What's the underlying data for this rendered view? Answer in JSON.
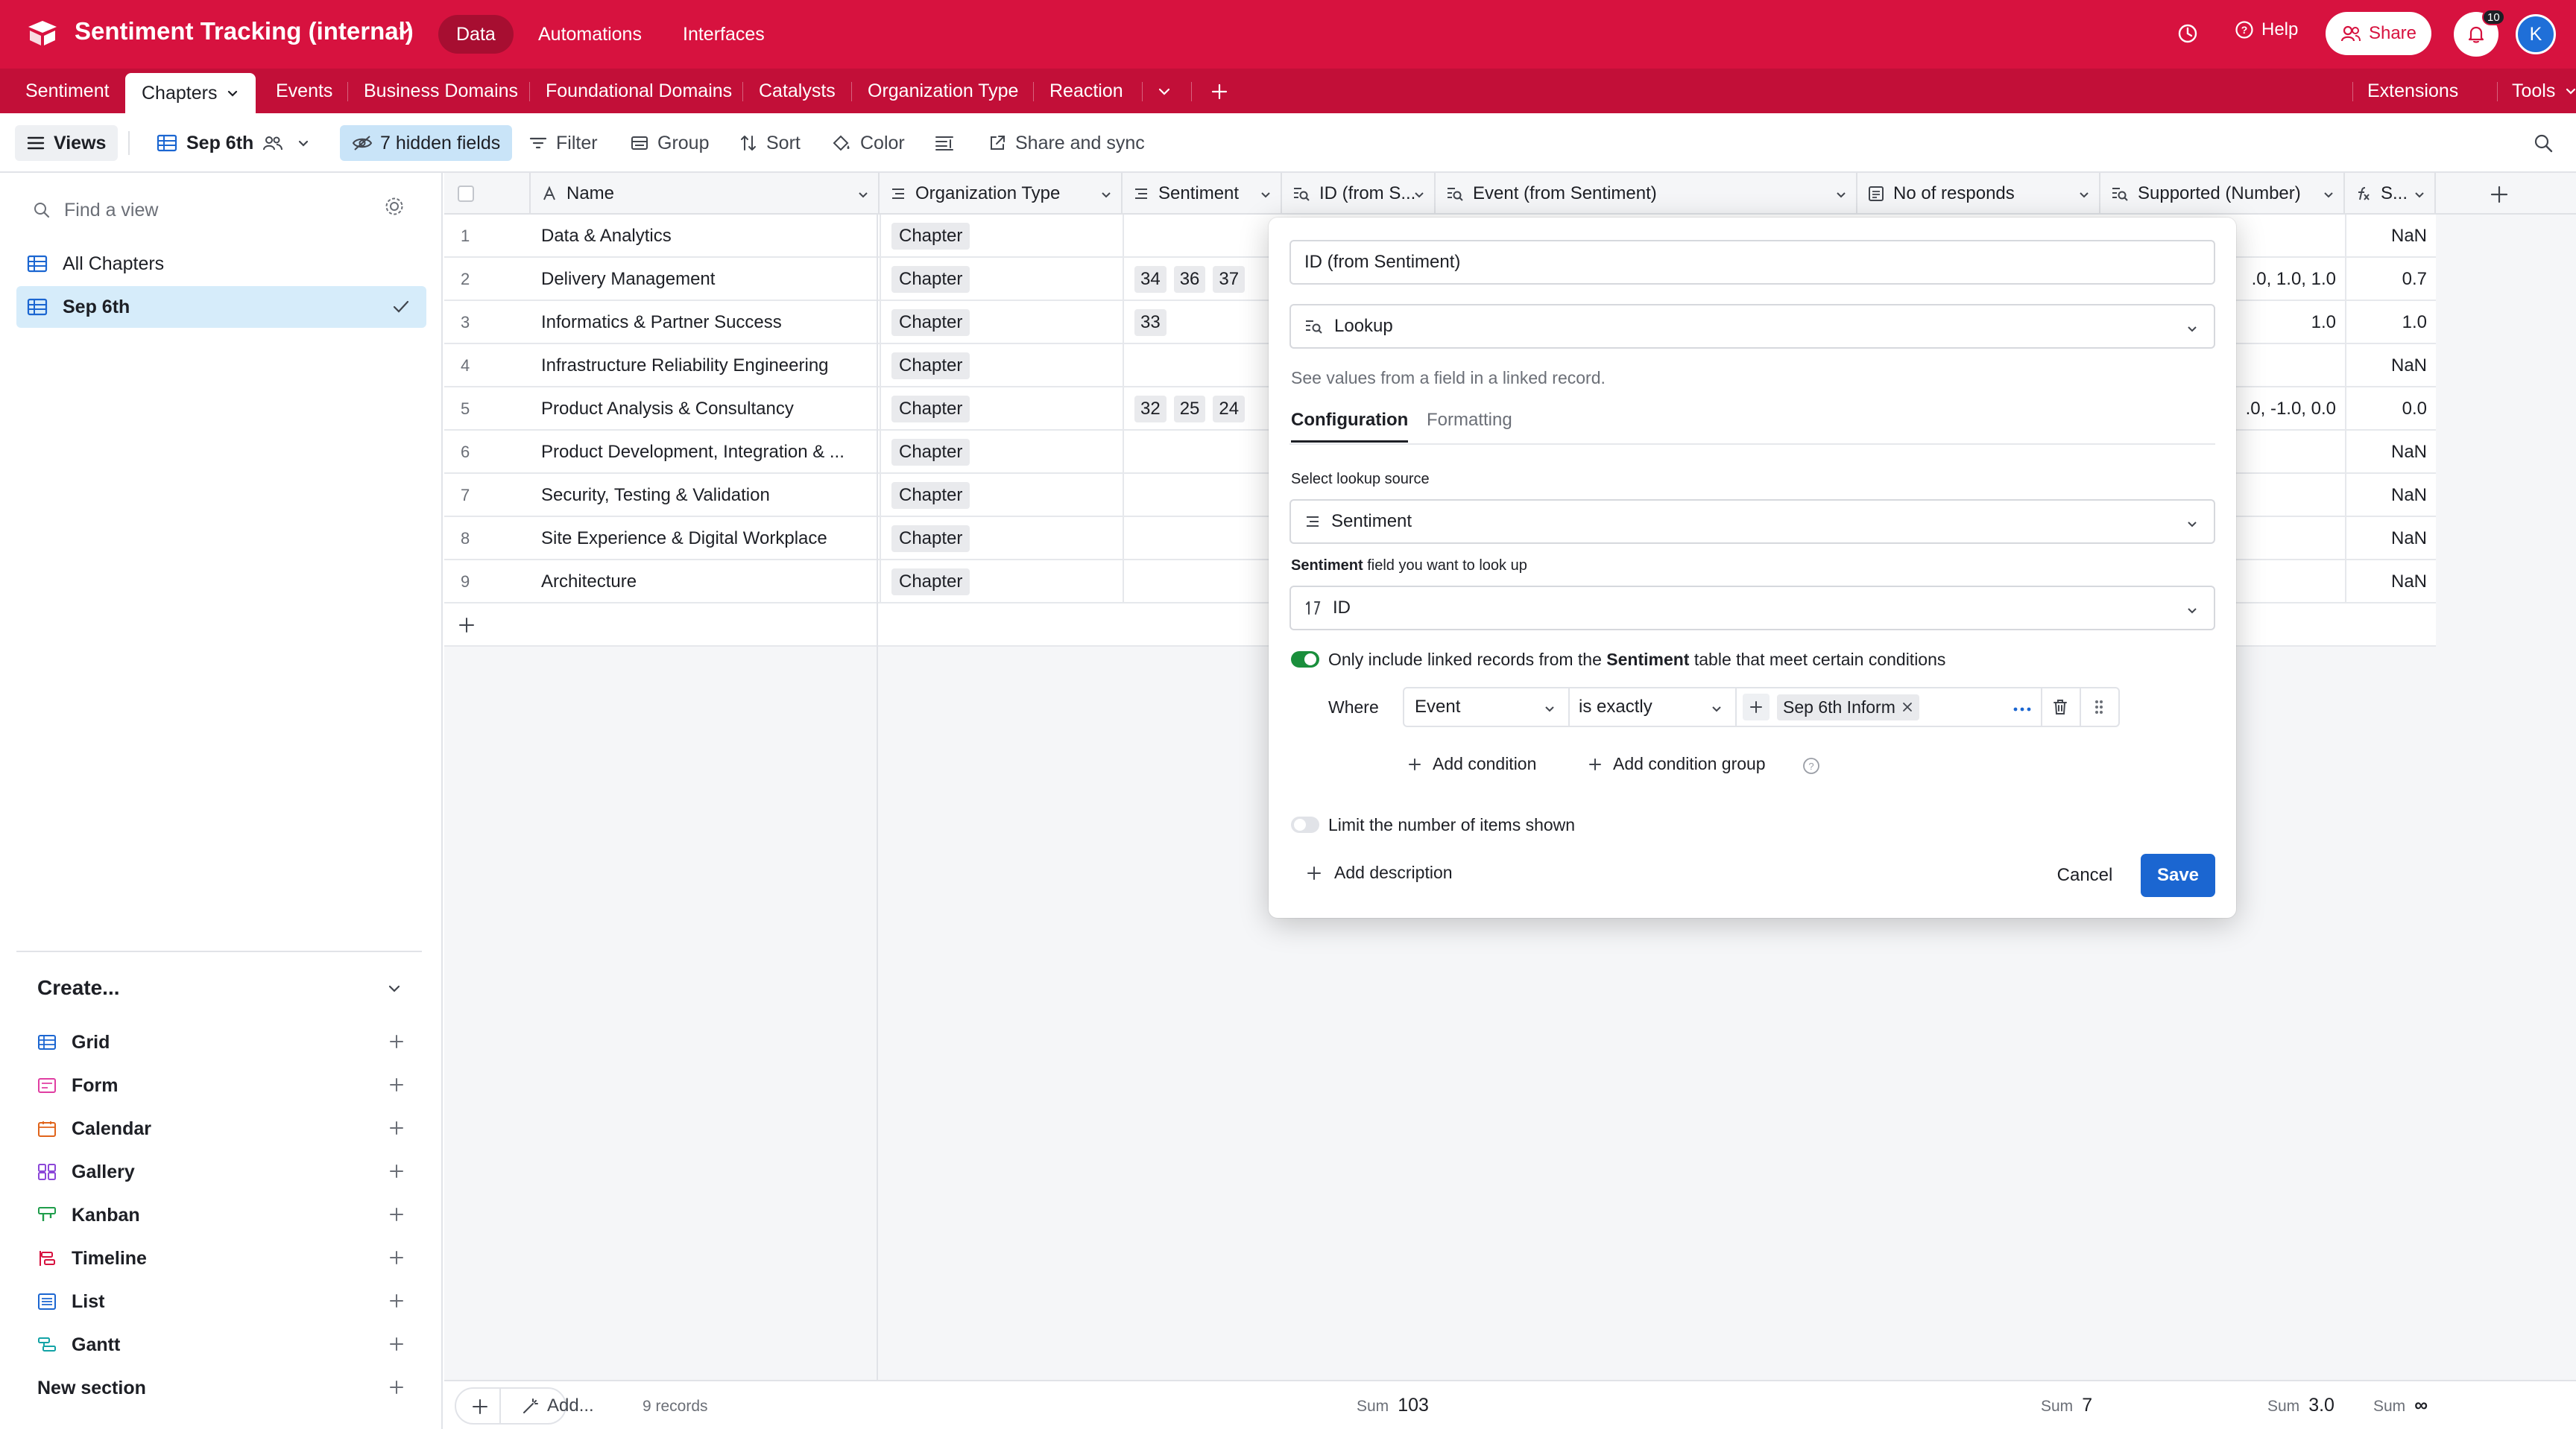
{
  "header": {
    "base_title": "Sentiment Tracking (internal)",
    "nav": [
      "Data",
      "Automations",
      "Interfaces"
    ],
    "help": "Help",
    "share": "Share",
    "notification_count": "10",
    "avatar_initial": "K"
  },
  "tables": {
    "items": [
      "Sentiment",
      "Chapters",
      "Events",
      "Business Domains",
      "Foundational Domains",
      "Catalysts",
      "Organization Type",
      "Reaction"
    ],
    "extensions": "Extensions",
    "tools": "Tools"
  },
  "viewbar": {
    "views": "Views",
    "current_view": "Sep 6th",
    "hidden_fields": "7 hidden fields",
    "filter": "Filter",
    "group": "Group",
    "sort": "Sort",
    "color": "Color",
    "share_sync": "Share and sync"
  },
  "sidebar": {
    "find_placeholder": "Find a view",
    "views": [
      "All Chapters",
      "Sep 6th"
    ],
    "create_label": "Create...",
    "create_items": [
      "Grid",
      "Form",
      "Calendar",
      "Gallery",
      "Kanban",
      "Timeline",
      "List",
      "Gantt",
      "New section"
    ]
  },
  "grid": {
    "columns": [
      "Name",
      "Organization Type",
      "Sentiment",
      "ID (from S...",
      "Event (from Sentiment)",
      "No of responds",
      "Supported (Number)",
      "S..."
    ],
    "rows": [
      {
        "num": "1",
        "name": "Data & Analytics",
        "type": "Chapter",
        "sentiment": [],
        "supported": "",
        "s": "NaN"
      },
      {
        "num": "2",
        "name": "Delivery Management",
        "type": "Chapter",
        "sentiment": [
          "34",
          "36",
          "37"
        ],
        "supported": ".0, 1.0, 1.0",
        "s": "0.7"
      },
      {
        "num": "3",
        "name": "Informatics & Partner Success",
        "type": "Chapter",
        "sentiment": [
          "33"
        ],
        "supported": "1.0",
        "s": "1.0"
      },
      {
        "num": "4",
        "name": "Infrastructure Reliability Engineering",
        "type": "Chapter",
        "sentiment": [],
        "supported": "",
        "s": "NaN"
      },
      {
        "num": "5",
        "name": "Product Analysis & Consultancy",
        "type": "Chapter",
        "sentiment": [
          "32",
          "25",
          "24"
        ],
        "supported": ".0, -1.0, 0.0",
        "s": "0.0"
      },
      {
        "num": "6",
        "name": "Product Development, Integration & ...",
        "type": "Chapter",
        "sentiment": [],
        "supported": "",
        "s": "NaN"
      },
      {
        "num": "7",
        "name": "Security, Testing & Validation",
        "type": "Chapter",
        "sentiment": [],
        "supported": "",
        "s": "NaN"
      },
      {
        "num": "8",
        "name": "Site Experience & Digital Workplace",
        "type": "Chapter",
        "sentiment": [],
        "supported": "",
        "s": "NaN"
      },
      {
        "num": "9",
        "name": "Architecture",
        "type": "Chapter",
        "sentiment": [],
        "supported": "",
        "s": "NaN"
      }
    ],
    "footer": {
      "add": "Add...",
      "records": "9 records",
      "sum_label": "Sum",
      "sum_id": "103",
      "sum_responds": "7",
      "sum_supported": "3.0",
      "sum_s": "∞"
    }
  },
  "dialog": {
    "field_name": "ID (from Sentiment)",
    "field_type": "Lookup",
    "type_desc": "See values from a field in a linked record.",
    "tabs": [
      "Configuration",
      "Formatting"
    ],
    "lookup_source_label": "Select lookup source",
    "lookup_source": "Sentiment",
    "field_label_bold": "Sentiment",
    "field_label_rest": " field you want to look up",
    "lookup_field": "ID",
    "condition_toggle_pre": "Only include linked records from the ",
    "condition_toggle_bold": "Sentiment",
    "condition_toggle_post": " table that meet certain conditions",
    "where": "Where",
    "cond_field": "Event",
    "cond_op": "is exactly",
    "cond_value": "Sep 6th Inform",
    "add_condition": "Add condition",
    "add_condition_group": "Add condition group",
    "limit_label": "Limit the number of items shown",
    "add_description": "Add description",
    "cancel": "Cancel",
    "save": "Save"
  }
}
